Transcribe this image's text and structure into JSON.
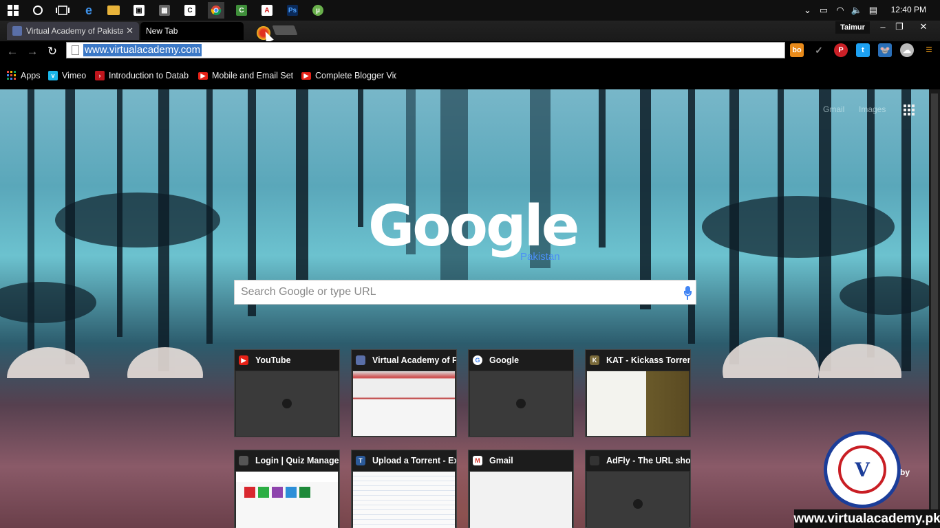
{
  "taskbar": {
    "clock": "12:40 PM"
  },
  "tabs": [
    {
      "title": "Virtual Academy of Pakistan",
      "active": false
    },
    {
      "title": "New Tab",
      "active": true
    }
  ],
  "profile": {
    "name": "Taimur"
  },
  "omnibox": {
    "url": "www.virtualacademy.com"
  },
  "extensions": [
    "bo",
    "✓",
    "P",
    "t",
    "🐭",
    "☁"
  ],
  "bookmarks": [
    {
      "label": "Apps",
      "icon": "apps-grid-icon"
    },
    {
      "label": "Vimeo",
      "icon": "vimeo-icon"
    },
    {
      "label": "Introduction to Datab",
      "icon": "arrow-bookmark-icon"
    },
    {
      "label": "Mobile and Email Setti",
      "icon": "youtube-icon"
    },
    {
      "label": "Complete Blogger Vid",
      "icon": "youtube-icon"
    }
  ],
  "ntp": {
    "gmail": "Gmail",
    "images": "Images",
    "logo": "Google",
    "logo_sub": "Pakistan",
    "search_placeholder": "Search Google or type URL",
    "tiles": [
      {
        "title": "YouTube",
        "icon": "youtube-icon",
        "thumb": "empty"
      },
      {
        "title": "Virtual Academy of Pa",
        "icon": "virtual-academy-icon",
        "thumb": "screenshot"
      },
      {
        "title": "Google",
        "icon": "google-icon",
        "thumb": "empty"
      },
      {
        "title": "KAT - Kickass Torrent",
        "icon": "kat-icon",
        "thumb": "screenshot"
      },
      {
        "title": "Login | Quiz Managem",
        "icon": "quiz-icon",
        "thumb": "screenshot"
      },
      {
        "title": "Upload a Torrent - Ext",
        "icon": "torrent-icon",
        "thumb": "screenshot"
      },
      {
        "title": "Gmail",
        "icon": "gmail-icon",
        "thumb": "light"
      },
      {
        "title": "AdFly - The URL shor",
        "icon": "adfly-icon",
        "thumb": "empty"
      }
    ]
  },
  "overlay": {
    "by": "by",
    "watermark": "www.virtualacademy.pk",
    "badge": "V"
  },
  "colors": {
    "accent": "#3b78c6",
    "google_blue": "#4285f4"
  }
}
